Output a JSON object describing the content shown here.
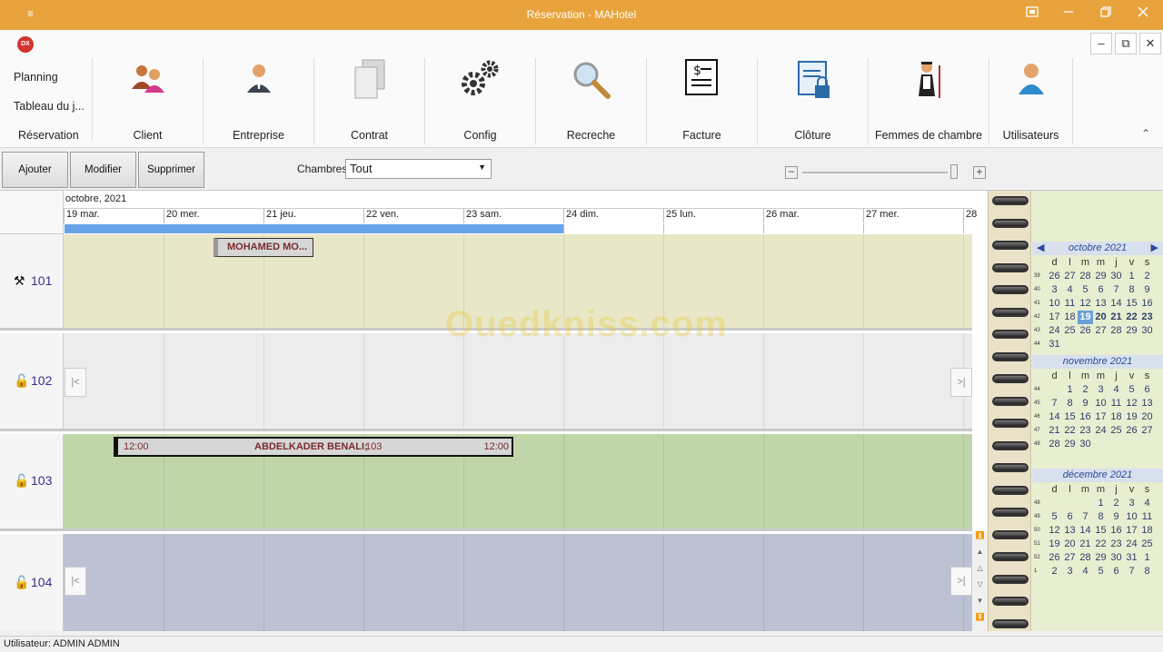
{
  "window": {
    "title": "Réservation - MAHotel",
    "menu_glyph": "≡"
  },
  "app_logo": "DX",
  "left_menu": {
    "planning": "Planning",
    "tableau": "Tableau du j...",
    "group": "Réservation"
  },
  "ribbon": [
    {
      "label": "Client",
      "icon": "clients-icon"
    },
    {
      "label": "Entreprise",
      "icon": "businessman-icon"
    },
    {
      "label": "Contrat",
      "icon": "documents-icon"
    },
    {
      "label": "Config",
      "icon": "gears-icon"
    },
    {
      "label": "Recreche",
      "icon": "magnifier-icon"
    },
    {
      "label": "Facture",
      "icon": "invoice-icon"
    },
    {
      "label": "Clôture",
      "icon": "secure-document-icon"
    },
    {
      "label": "Femmes de chambre",
      "icon": "housekeeper-icon"
    },
    {
      "label": "Utilisateurs",
      "icon": "user-icon"
    }
  ],
  "toolbar": {
    "add": "Ajouter",
    "modify": "Modifier",
    "delete": "Supprimer",
    "rooms_label": "Chambres",
    "rooms_value": "Tout",
    "zoom_minus": "−",
    "zoom_plus": "+"
  },
  "schedule": {
    "month": "octobre, 2021",
    "days": [
      "19 mar.",
      "20 mer.",
      "21 jeu.",
      "22 ven.",
      "23 sam.",
      "24 dim.",
      "25 lun.",
      "26 mar.",
      "27 mer.",
      "28"
    ],
    "rooms": [
      {
        "number": "101",
        "status_icon": "tools-icon",
        "color": "#e8e8c8"
      },
      {
        "number": "102",
        "status_icon": "unlocked-icon",
        "color": "#ececec"
      },
      {
        "number": "103",
        "status_icon": "unlocked-icon",
        "color": "#c0d6a8"
      },
      {
        "number": "104",
        "status_icon": "unlocked-icon",
        "color": "#bcc2d3"
      }
    ],
    "bookings": [
      {
        "label": "MOHAMED MO..."
      },
      {
        "label": "ABDELKADER BENALI;",
        "room": "103",
        "start_time": "12:00",
        "end_time": "12:00"
      }
    ],
    "nav_prev": "|<",
    "nav_next": ">|"
  },
  "watermark": "Ouedkniss.com",
  "calendar": {
    "dow": [
      "d",
      "l",
      "m",
      "m",
      "j",
      "v",
      "s"
    ],
    "months": [
      {
        "title": "octobre 2021",
        "weeks": [
          [
            "39",
            "26",
            "27",
            "28",
            "29",
            "30",
            "1",
            "2"
          ],
          [
            "40",
            "3",
            "4",
            "5",
            "6",
            "7",
            "8",
            "9"
          ],
          [
            "41",
            "10",
            "11",
            "12",
            "13",
            "14",
            "15",
            "16"
          ],
          [
            "42",
            "17",
            "18",
            "19",
            "20",
            "21",
            "22",
            "23"
          ],
          [
            "43",
            "24",
            "25",
            "26",
            "27",
            "28",
            "29",
            "30"
          ],
          [
            "44",
            "31",
            "",
            "",
            "",
            "",
            "",
            ""
          ]
        ]
      },
      {
        "title": "novembre 2021",
        "weeks": [
          [
            "44",
            "",
            "1",
            "2",
            "3",
            "4",
            "5",
            "6"
          ],
          [
            "45",
            "7",
            "8",
            "9",
            "10",
            "11",
            "12",
            "13"
          ],
          [
            "46",
            "14",
            "15",
            "16",
            "17",
            "18",
            "19",
            "20"
          ],
          [
            "47",
            "21",
            "22",
            "23",
            "24",
            "25",
            "26",
            "27"
          ],
          [
            "48",
            "28",
            "29",
            "30",
            "",
            "",
            "",
            ""
          ]
        ]
      },
      {
        "title": "décembre 2021",
        "weeks": [
          [
            "48",
            "",
            "",
            "",
            "1",
            "2",
            "3",
            "4"
          ],
          [
            "49",
            "5",
            "6",
            "7",
            "8",
            "9",
            "10",
            "11"
          ],
          [
            "50",
            "12",
            "13",
            "14",
            "15",
            "16",
            "17",
            "18"
          ],
          [
            "51",
            "19",
            "20",
            "21",
            "22",
            "23",
            "24",
            "25"
          ],
          [
            "52",
            "26",
            "27",
            "28",
            "29",
            "30",
            "31",
            "1"
          ],
          [
            "1",
            "2",
            "3",
            "4",
            "5",
            "6",
            "7",
            "8"
          ]
        ]
      }
    ],
    "today": "19"
  },
  "status": {
    "user": "Utilisateur: ADMIN ADMIN"
  }
}
